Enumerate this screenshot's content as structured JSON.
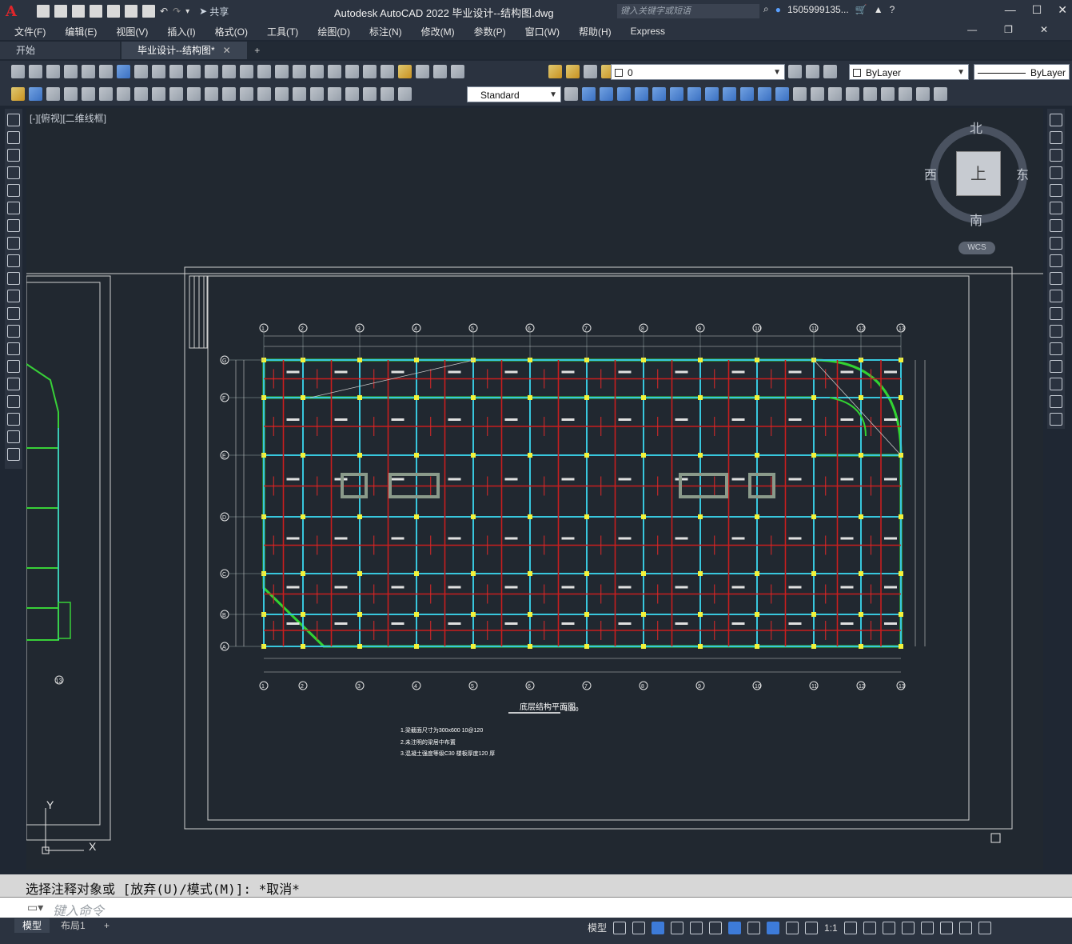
{
  "app": {
    "logo": "A",
    "title": "Autodesk AutoCAD 2022    毕业设计--结构图.dwg",
    "share_label": "共享",
    "search_placeholder": "键入关键字或短语",
    "user": "1505999135...",
    "help": "?"
  },
  "menu": [
    "文件(F)",
    "编辑(E)",
    "视图(V)",
    "插入(I)",
    "格式(O)",
    "工具(T)",
    "绘图(D)",
    "标注(N)",
    "修改(M)",
    "参数(P)",
    "窗口(W)",
    "帮助(H)",
    "Express"
  ],
  "tabs": [
    {
      "label": "开始"
    },
    {
      "label": "毕业设计--结构图*"
    }
  ],
  "toolbar": {
    "layer_value": "0",
    "color_value": "ByLayer",
    "linetype_value": "ByLayer",
    "textstyle_value": "Standard"
  },
  "viewport": {
    "label": "[-][俯视][二维线框]"
  },
  "viewcube": {
    "north": "北",
    "south": "南",
    "east": "东",
    "west": "西",
    "face": "上",
    "wcs": "WCS"
  },
  "ucs": {
    "y": "Y",
    "x": "X"
  },
  "drawing": {
    "title": "底层结构平面图",
    "scale": "1:100",
    "grid_cols": [
      "1",
      "2",
      "3",
      "4",
      "5",
      "6",
      "7",
      "8",
      "9",
      "10",
      "11",
      "12",
      "13"
    ],
    "grid_rows": [
      "G",
      "F",
      "E",
      "D",
      "C",
      "B",
      "A"
    ],
    "notes": [
      "1.梁截面尺寸为300x600  10@120",
      "2.未注明的梁居中布置",
      "3.混凝土强度等级C30  楼板厚度120  厚"
    ],
    "left_label": "13"
  },
  "command": {
    "history": "选择注释对象或 [放弃(U)/模式(M)]: *取消*",
    "placeholder": "键入命令"
  },
  "status": {
    "model_tab": "模型",
    "layout_tab": "布局1",
    "add": "+",
    "model_btn": "模型",
    "scale": "1:1"
  }
}
